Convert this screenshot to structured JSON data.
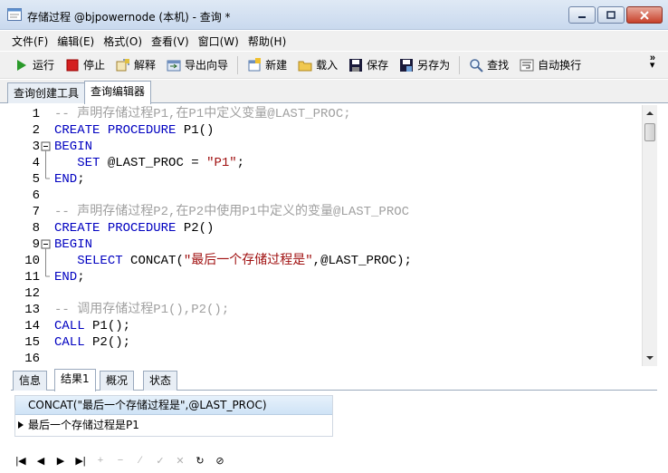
{
  "window": {
    "title": "存储过程 @bjpowernode (本机) - 查询 *"
  },
  "menu": [
    "文件(F)",
    "编辑(E)",
    "格式(O)",
    "查看(V)",
    "窗口(W)",
    "帮助(H)"
  ],
  "toolbar": {
    "run": "运行",
    "stop": "停止",
    "explain": "解释",
    "export_wizard": "导出向导",
    "new": "新建",
    "load": "载入",
    "save": "保存",
    "save_as": "另存为",
    "find": "查找",
    "word_wrap": "自动换行"
  },
  "top_tabs": [
    "查询创建工具",
    "查询编辑器"
  ],
  "editor": {
    "line_numbers": [
      "1",
      "2",
      "3",
      "4",
      "5",
      "6",
      "7",
      "8",
      "9",
      "10",
      "11",
      "12",
      "13",
      "14",
      "15",
      "16"
    ],
    "lines": [
      [
        {
          "t": "-- 声明存储过程P1,在P1中定义变量@LAST_PROC;",
          "c": "cm"
        }
      ],
      [
        {
          "t": "CREATE",
          "c": "kw"
        },
        {
          "t": " ",
          "c": ""
        },
        {
          "t": "PROCEDURE",
          "c": "kw"
        },
        {
          "t": " P1()",
          "c": ""
        }
      ],
      [
        {
          "t": "BEGIN",
          "c": "kw"
        }
      ],
      [
        {
          "t": "   ",
          "c": ""
        },
        {
          "t": "SET",
          "c": "kw"
        },
        {
          "t": " @LAST_PROC = ",
          "c": ""
        },
        {
          "t": "\"P1\"",
          "c": "st"
        },
        {
          "t": ";",
          "c": ""
        }
      ],
      [
        {
          "t": "END",
          "c": "kw"
        },
        {
          "t": ";",
          "c": ""
        }
      ],
      [],
      [
        {
          "t": "-- 声明存储过程P2,在P2中使用P1中定义的变量@LAST_PROC",
          "c": "cm"
        }
      ],
      [
        {
          "t": "CREATE",
          "c": "kw"
        },
        {
          "t": " ",
          "c": ""
        },
        {
          "t": "PROCEDURE",
          "c": "kw"
        },
        {
          "t": " P2()",
          "c": ""
        }
      ],
      [
        {
          "t": "BEGIN",
          "c": "kw"
        }
      ],
      [
        {
          "t": "   ",
          "c": ""
        },
        {
          "t": "SELECT",
          "c": "kw"
        },
        {
          "t": " CONCAT(",
          "c": ""
        },
        {
          "t": "\"最后一个存储过程是\"",
          "c": "st"
        },
        {
          "t": ",@LAST_PROC);",
          "c": ""
        }
      ],
      [
        {
          "t": "END",
          "c": "kw"
        },
        {
          "t": ";",
          "c": ""
        }
      ],
      [],
      [
        {
          "t": "-- 调用存储过程P1(),P2();",
          "c": "cm"
        }
      ],
      [
        {
          "t": "CALL",
          "c": "kw"
        },
        {
          "t": " P1();",
          "c": ""
        }
      ],
      [
        {
          "t": "CALL",
          "c": "kw"
        },
        {
          "t": " P2();",
          "c": ""
        }
      ],
      []
    ]
  },
  "bottom_tabs": [
    "信息",
    "结果1",
    "概况",
    "状态"
  ],
  "result": {
    "column": "CONCAT(\"最后一个存储过程是\",@LAST_PROC)",
    "value": "最后一个存储过程是P1"
  },
  "colors": {
    "keyword": "#0000c0",
    "comment": "#a0a0a0",
    "string": "#a01010"
  }
}
